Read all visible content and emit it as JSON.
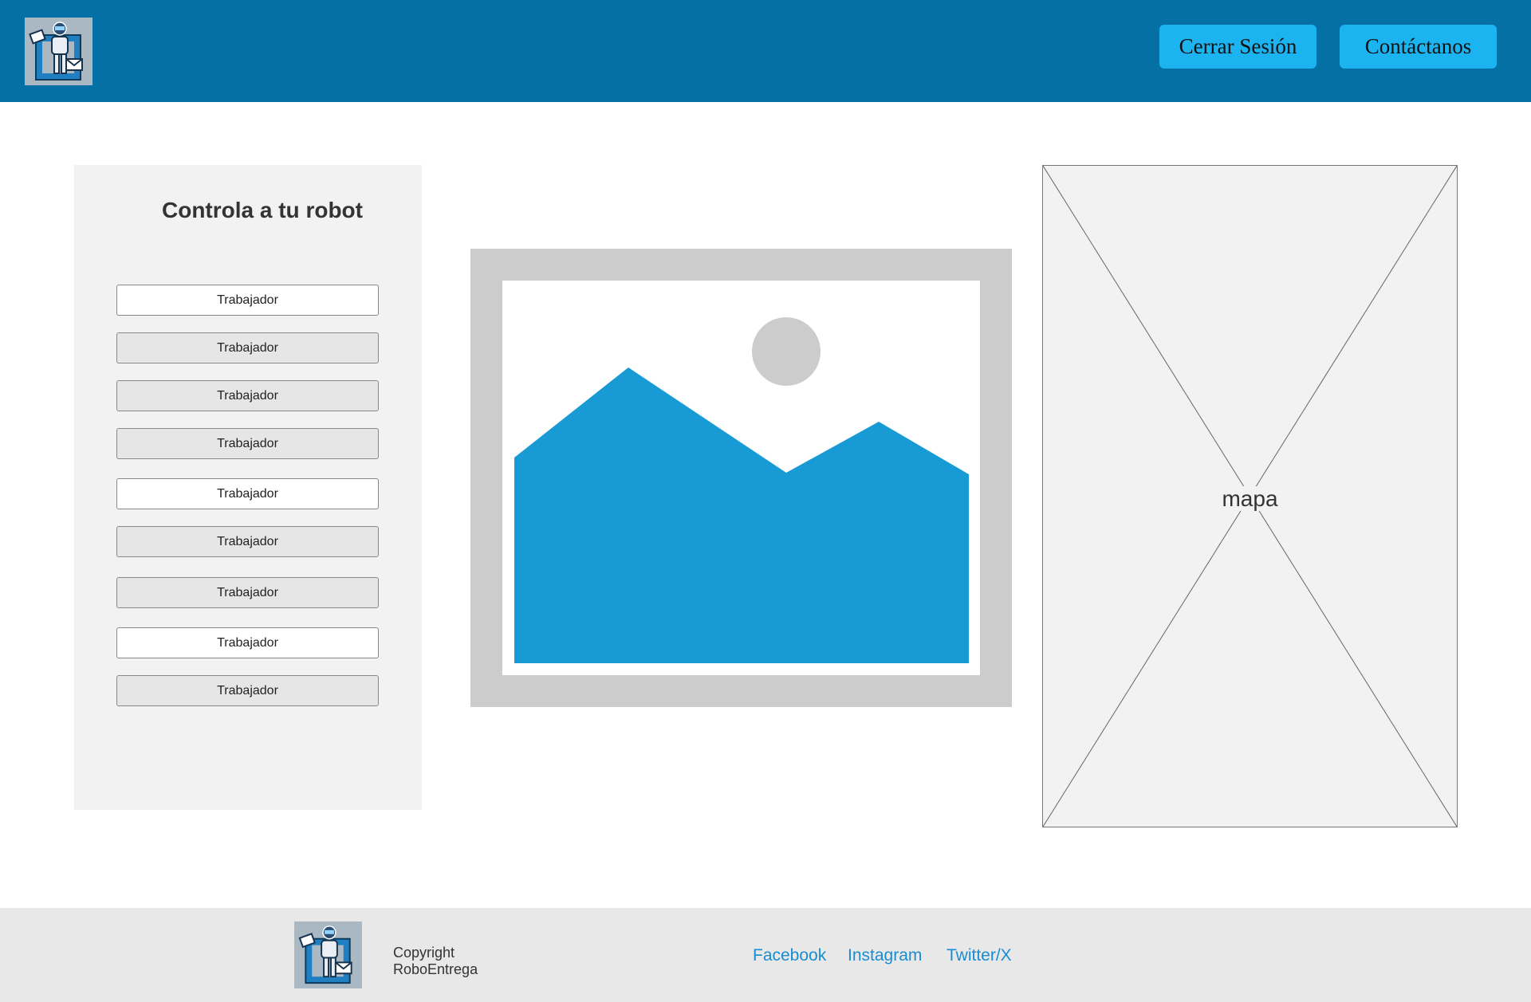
{
  "header": {
    "logout_label": "Cerrar Sesión",
    "contact_label": "Contáctanos"
  },
  "panel": {
    "title": "Controla a tu robot",
    "workers": [
      {
        "label": "Trabajador",
        "style": "white"
      },
      {
        "label": "Trabajador",
        "style": "grey"
      },
      {
        "label": "Trabajador",
        "style": "grey"
      },
      {
        "label": "Trabajador",
        "style": "grey"
      },
      {
        "label": "Trabajador",
        "style": "white"
      },
      {
        "label": "Trabajador",
        "style": "grey"
      },
      {
        "label": "Trabajador",
        "style": "grey"
      },
      {
        "label": "Trabajador",
        "style": "white"
      },
      {
        "label": "Trabajador",
        "style": "grey"
      }
    ]
  },
  "map": {
    "label": "mapa"
  },
  "footer": {
    "copyright_line1": "Copyright",
    "copyright_line2": "RoboEntrega",
    "links": {
      "facebook": "Facebook",
      "instagram": "Instagram",
      "twitter": "Twitter/X"
    }
  },
  "colors": {
    "header_bg": "#0470a3",
    "button_bg": "#1cb4f0",
    "link": "#1a8cd0",
    "image_blue": "#189bd5"
  }
}
